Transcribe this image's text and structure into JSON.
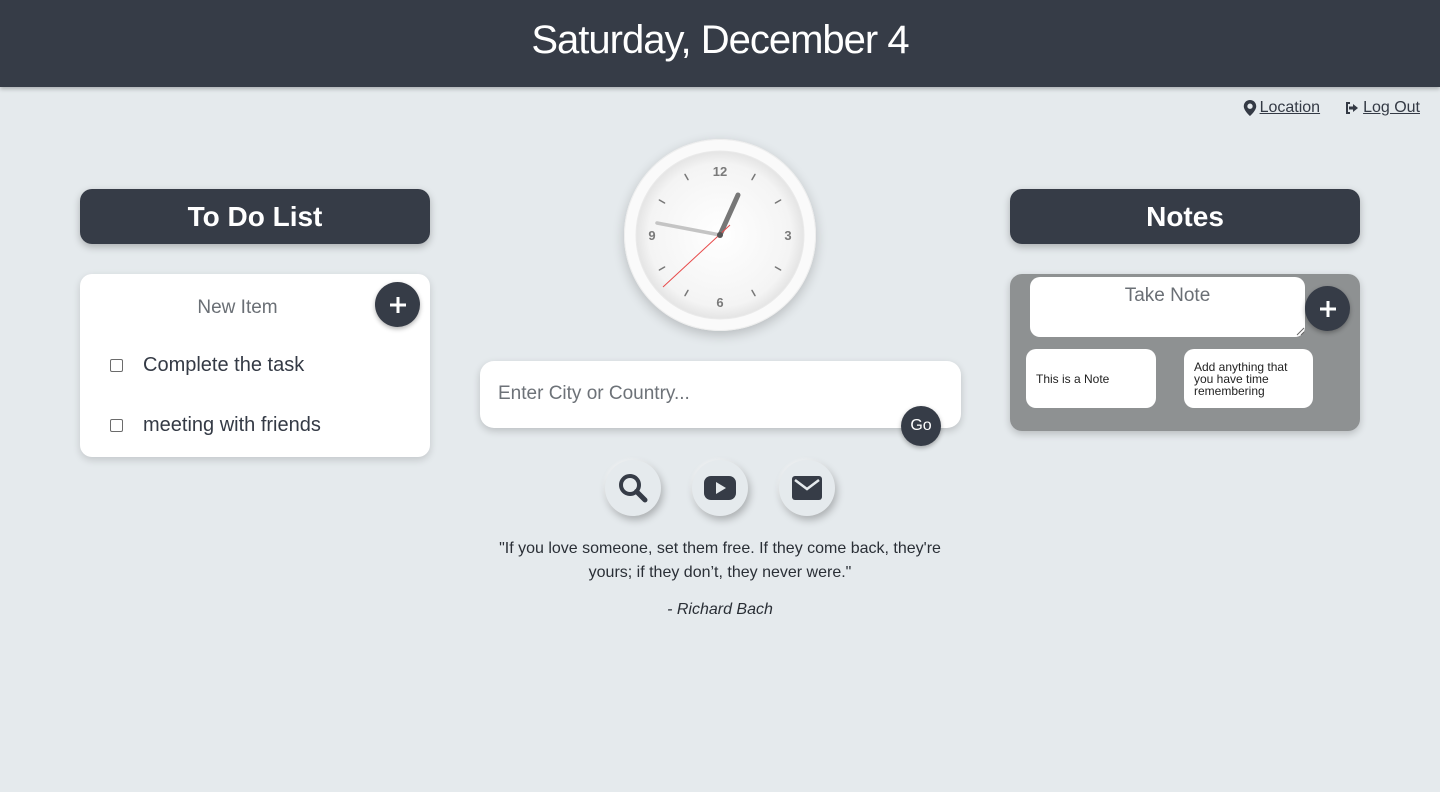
{
  "header": {
    "date": "Saturday, December 4"
  },
  "toplinks": {
    "location": "Location",
    "logout": "Log Out"
  },
  "todo": {
    "title": "To Do List",
    "input_placeholder": "New Item",
    "items": [
      {
        "label": "Complete the task",
        "checked": false
      },
      {
        "label": "meeting with friends",
        "checked": false
      }
    ]
  },
  "clock": {
    "numerals": {
      "top": "12",
      "right": "3",
      "bottom": "6",
      "left": "9"
    }
  },
  "search": {
    "placeholder": "Enter City or Country...",
    "go_label": "Go"
  },
  "quick_links": [
    "search-icon",
    "youtube-icon",
    "mail-icon"
  ],
  "quote": {
    "text": "\"If you love someone, set them free. If they come back, they're yours; if they don’t, they never were.\"",
    "author": "- Richard Bach"
  },
  "notes": {
    "title": "Notes",
    "input_placeholder": "Take Note",
    "items": [
      "This is a Note",
      "Add anything that you have time remembering"
    ]
  },
  "colors": {
    "header_bg": "#363c47",
    "page_bg": "#e5eaed",
    "notes_card_bg": "#8e9192",
    "second_hand": "#e84a4a"
  }
}
